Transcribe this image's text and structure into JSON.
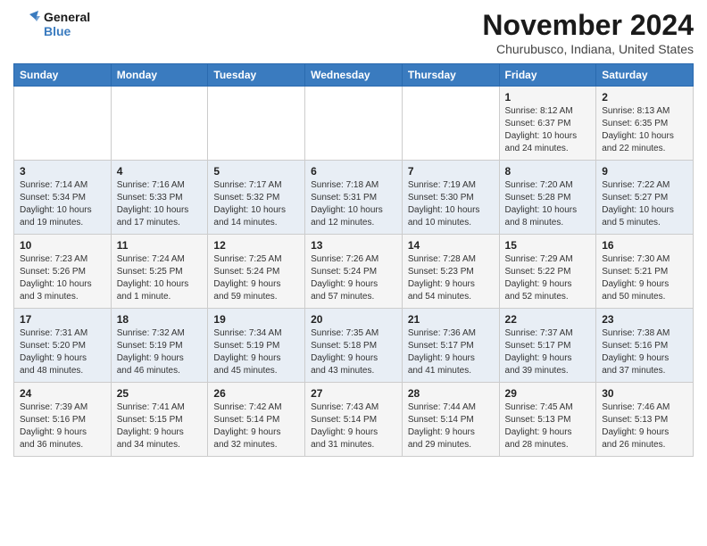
{
  "logo": {
    "line1": "General",
    "line2": "Blue"
  },
  "title": "November 2024",
  "location": "Churubusco, Indiana, United States",
  "weekdays": [
    "Sunday",
    "Monday",
    "Tuesday",
    "Wednesday",
    "Thursday",
    "Friday",
    "Saturday"
  ],
  "weeks": [
    [
      {
        "day": "",
        "info": ""
      },
      {
        "day": "",
        "info": ""
      },
      {
        "day": "",
        "info": ""
      },
      {
        "day": "",
        "info": ""
      },
      {
        "day": "",
        "info": ""
      },
      {
        "day": "1",
        "info": "Sunrise: 8:12 AM\nSunset: 6:37 PM\nDaylight: 10 hours\nand 24 minutes."
      },
      {
        "day": "2",
        "info": "Sunrise: 8:13 AM\nSunset: 6:35 PM\nDaylight: 10 hours\nand 22 minutes."
      }
    ],
    [
      {
        "day": "3",
        "info": "Sunrise: 7:14 AM\nSunset: 5:34 PM\nDaylight: 10 hours\nand 19 minutes."
      },
      {
        "day": "4",
        "info": "Sunrise: 7:16 AM\nSunset: 5:33 PM\nDaylight: 10 hours\nand 17 minutes."
      },
      {
        "day": "5",
        "info": "Sunrise: 7:17 AM\nSunset: 5:32 PM\nDaylight: 10 hours\nand 14 minutes."
      },
      {
        "day": "6",
        "info": "Sunrise: 7:18 AM\nSunset: 5:31 PM\nDaylight: 10 hours\nand 12 minutes."
      },
      {
        "day": "7",
        "info": "Sunrise: 7:19 AM\nSunset: 5:30 PM\nDaylight: 10 hours\nand 10 minutes."
      },
      {
        "day": "8",
        "info": "Sunrise: 7:20 AM\nSunset: 5:28 PM\nDaylight: 10 hours\nand 8 minutes."
      },
      {
        "day": "9",
        "info": "Sunrise: 7:22 AM\nSunset: 5:27 PM\nDaylight: 10 hours\nand 5 minutes."
      }
    ],
    [
      {
        "day": "10",
        "info": "Sunrise: 7:23 AM\nSunset: 5:26 PM\nDaylight: 10 hours\nand 3 minutes."
      },
      {
        "day": "11",
        "info": "Sunrise: 7:24 AM\nSunset: 5:25 PM\nDaylight: 10 hours\nand 1 minute."
      },
      {
        "day": "12",
        "info": "Sunrise: 7:25 AM\nSunset: 5:24 PM\nDaylight: 9 hours\nand 59 minutes."
      },
      {
        "day": "13",
        "info": "Sunrise: 7:26 AM\nSunset: 5:24 PM\nDaylight: 9 hours\nand 57 minutes."
      },
      {
        "day": "14",
        "info": "Sunrise: 7:28 AM\nSunset: 5:23 PM\nDaylight: 9 hours\nand 54 minutes."
      },
      {
        "day": "15",
        "info": "Sunrise: 7:29 AM\nSunset: 5:22 PM\nDaylight: 9 hours\nand 52 minutes."
      },
      {
        "day": "16",
        "info": "Sunrise: 7:30 AM\nSunset: 5:21 PM\nDaylight: 9 hours\nand 50 minutes."
      }
    ],
    [
      {
        "day": "17",
        "info": "Sunrise: 7:31 AM\nSunset: 5:20 PM\nDaylight: 9 hours\nand 48 minutes."
      },
      {
        "day": "18",
        "info": "Sunrise: 7:32 AM\nSunset: 5:19 PM\nDaylight: 9 hours\nand 46 minutes."
      },
      {
        "day": "19",
        "info": "Sunrise: 7:34 AM\nSunset: 5:19 PM\nDaylight: 9 hours\nand 45 minutes."
      },
      {
        "day": "20",
        "info": "Sunrise: 7:35 AM\nSunset: 5:18 PM\nDaylight: 9 hours\nand 43 minutes."
      },
      {
        "day": "21",
        "info": "Sunrise: 7:36 AM\nSunset: 5:17 PM\nDaylight: 9 hours\nand 41 minutes."
      },
      {
        "day": "22",
        "info": "Sunrise: 7:37 AM\nSunset: 5:17 PM\nDaylight: 9 hours\nand 39 minutes."
      },
      {
        "day": "23",
        "info": "Sunrise: 7:38 AM\nSunset: 5:16 PM\nDaylight: 9 hours\nand 37 minutes."
      }
    ],
    [
      {
        "day": "24",
        "info": "Sunrise: 7:39 AM\nSunset: 5:16 PM\nDaylight: 9 hours\nand 36 minutes."
      },
      {
        "day": "25",
        "info": "Sunrise: 7:41 AM\nSunset: 5:15 PM\nDaylight: 9 hours\nand 34 minutes."
      },
      {
        "day": "26",
        "info": "Sunrise: 7:42 AM\nSunset: 5:14 PM\nDaylight: 9 hours\nand 32 minutes."
      },
      {
        "day": "27",
        "info": "Sunrise: 7:43 AM\nSunset: 5:14 PM\nDaylight: 9 hours\nand 31 minutes."
      },
      {
        "day": "28",
        "info": "Sunrise: 7:44 AM\nSunset: 5:14 PM\nDaylight: 9 hours\nand 29 minutes."
      },
      {
        "day": "29",
        "info": "Sunrise: 7:45 AM\nSunset: 5:13 PM\nDaylight: 9 hours\nand 28 minutes."
      },
      {
        "day": "30",
        "info": "Sunrise: 7:46 AM\nSunset: 5:13 PM\nDaylight: 9 hours\nand 26 minutes."
      }
    ]
  ]
}
